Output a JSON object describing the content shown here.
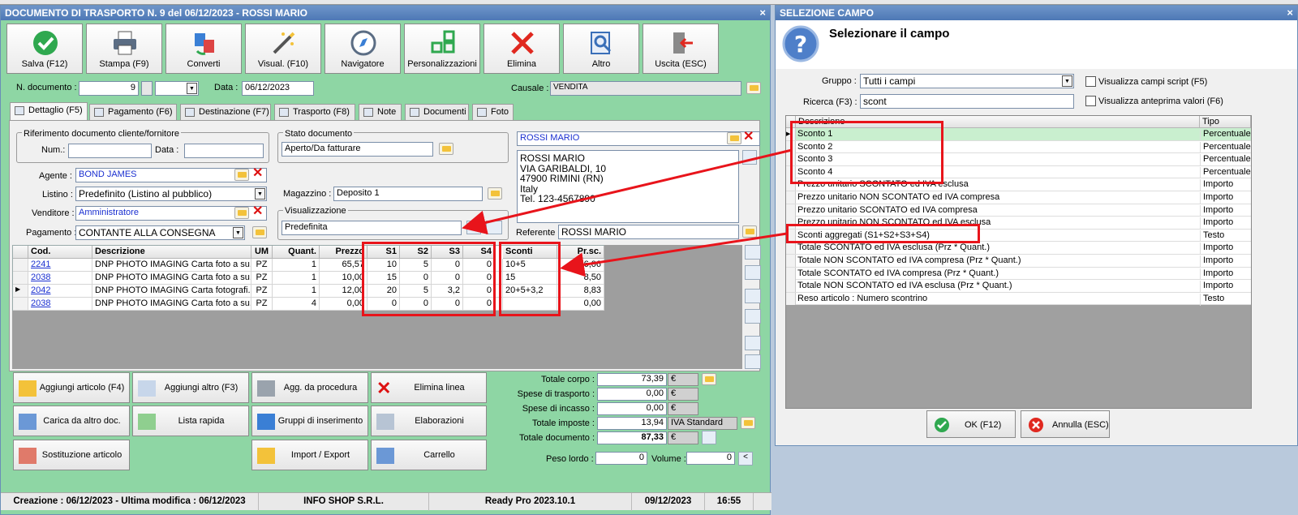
{
  "main": {
    "title": "DOCUMENTO DI TRASPORTO N. 9 del 06/12/2023 - ROSSI MARIO",
    "toolbar": [
      "Salva (F12)",
      "Stampa (F9)",
      "Converti",
      "Visual. (F10)",
      "Navigatore",
      "Personalizzazioni",
      "Elimina",
      "Altro",
      "Uscita (ESC)"
    ],
    "num_doc_label": "N. documento :",
    "num_doc_value": "9",
    "data_label": "Data :",
    "data_value": "06/12/2023",
    "causale_label": "Causale :",
    "causale_value": "VENDITA",
    "tabs": [
      "Dettaglio (F5)",
      "Pagamento (F6)",
      "Destinazione (F7)",
      "Trasporto (F8)",
      "Note",
      "Documenti",
      "Foto"
    ],
    "rif_title": "Riferimento documento cliente/fornitore",
    "num_label": "Num.:",
    "data2_label": "Data :",
    "stato_title": "Stato documento",
    "stato_value": "Aperto/Da fatturare",
    "cliente_name": "ROSSI MARIO",
    "address": [
      "ROSSI MARIO",
      "VIA GARIBALDI, 10",
      "47900 RIMINI (RN)",
      "Italy",
      "Tel. 123-4567890"
    ],
    "agente_label": "Agente :",
    "agente_value": "BOND JAMES",
    "listino_label": "Listino :",
    "listino_value": "Predefinito (Listino al pubblico)",
    "venditore_label": "Venditore :",
    "venditore_value": "Amministratore",
    "pagamento_label": "Pagamento :",
    "pagamento_value": "CONTANTE ALLA CONSEGNA",
    "magazzino_label": "Magazzino :",
    "magazzino_value": "Deposito 1",
    "visual_title": "Visualizzazione",
    "visual_value": "Predefinita",
    "referente_label": "Referente",
    "referente_value": "ROSSI MARIO",
    "grid": {
      "headers": [
        "Cod.",
        "Descrizione",
        "UM",
        "Quant.",
        "Prezzo",
        "S1",
        "S2",
        "S3",
        "S4",
        "Sconti",
        "Pr.sc."
      ],
      "rows": [
        [
          "2241",
          "DNP PHOTO IMAGING Carta foto a su...",
          "PZ",
          "1",
          "65,57",
          "10",
          "5",
          "0",
          "0",
          "10+5",
          "56,06"
        ],
        [
          "2038",
          "DNP PHOTO IMAGING Carta foto a su...",
          "PZ",
          "1",
          "10,00",
          "15",
          "0",
          "0",
          "0",
          "15",
          "8,50"
        ],
        [
          "2042",
          "DNP PHOTO IMAGING Carta fotografi...",
          "PZ",
          "1",
          "12,00",
          "20",
          "5",
          "3,2",
          "0",
          "20+5+3,2",
          "8,83"
        ],
        [
          "2038",
          "DNP PHOTO IMAGING Carta foto a su...",
          "PZ",
          "4",
          "0,00",
          "0",
          "0",
          "0",
          "0",
          "",
          "0,00"
        ]
      ]
    },
    "bottom_buttons": [
      "Aggiungi articolo (F4)",
      "Aggiungi altro (F3)",
      "Agg. da procedura",
      "Elimina linea",
      "Carica da altro doc.",
      "Lista rapida",
      "Gruppi di inserimento",
      "Elaborazioni",
      "Sostituzione articolo",
      "Import / Export",
      "Carrello"
    ],
    "totals": {
      "corpo_label": "Totale corpo :",
      "corpo": "73,39",
      "trasporto_label": "Spese di trasporto :",
      "trasporto": "0,00",
      "incasso_label": "Spese di incasso :",
      "incasso": "0,00",
      "imposte_label": "Totale imposte :",
      "imposte": "13,94",
      "iva": "IVA Standard",
      "documento_label": "Totale documento :",
      "documento": "87,33",
      "currency": "€",
      "peso_label": "Peso lordo :",
      "peso": "0",
      "volume_label": "Volume :",
      "volume": "0"
    },
    "status": [
      "Creazione : 06/12/2023 - Ultima modifica : 06/12/2023",
      "INFO SHOP S.R.L.",
      "Ready Pro 2023.10.1",
      "09/12/2023",
      "16:55"
    ]
  },
  "dialog": {
    "title": "SELEZIONE CAMPO",
    "heading": "Selezionare il campo",
    "gruppo_label": "Gruppo :",
    "gruppo_value": "Tutti i campi",
    "ricerca_label": "Ricerca (F3) :",
    "ricerca_value": "scont",
    "chk1": "Visualizza campi script (F5)",
    "chk2": "Visualizza anteprima valori (F6)",
    "col_desc": "Descrizione",
    "col_tipo": "Tipo",
    "rows": [
      [
        "Sconto 1",
        "Percentuale"
      ],
      [
        "Sconto 2",
        "Percentuale"
      ],
      [
        "Sconto 3",
        "Percentuale"
      ],
      [
        "Sconto 4",
        "Percentuale"
      ],
      [
        "Prezzo unitario SCONTATO ed IVA esclusa",
        "Importo"
      ],
      [
        "Prezzo unitario NON SCONTATO ed IVA compresa",
        "Importo"
      ],
      [
        "Prezzo unitario SCONTATO ed IVA compresa",
        "Importo"
      ],
      [
        "Prezzo unitario NON SCONTATO ed IVA esclusa",
        "Importo"
      ],
      [
        "Sconti aggregati (S1+S2+S3+S4)",
        "Testo"
      ],
      [
        "Totale SCONTATO ed IVA esclusa (Prz * Quant.)",
        "Importo"
      ],
      [
        "Totale NON SCONTATO ed IVA compresa (Prz * Quant.)",
        "Importo"
      ],
      [
        "Totale SCONTATO ed IVA compresa (Prz * Quant.)",
        "Importo"
      ],
      [
        "Totale NON SCONTATO ed IVA esclusa (Prz * Quant.)",
        "Importo"
      ],
      [
        "Reso articolo : Numero scontrino",
        "Testo"
      ]
    ],
    "ok": "OK (F12)",
    "annulla": "Annulla (ESC)"
  },
  "colors": {
    "accent_green": "#8ed6a4",
    "title_blue": "#4d78b5",
    "highlight_red": "#e8141b",
    "selected_row": "#c9efcf"
  }
}
